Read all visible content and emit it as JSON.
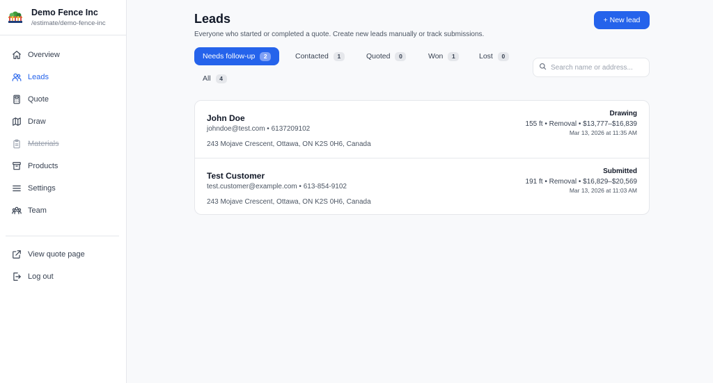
{
  "brand": {
    "name": "Demo Fence Inc",
    "path": "/estimate/demo-fence-inc",
    "logo_icon": "fence-logo-icon"
  },
  "sidebar": {
    "items": [
      {
        "label": "Overview",
        "icon": "home-icon"
      },
      {
        "label": "Leads",
        "icon": "users-icon",
        "active": true
      },
      {
        "label": "Quote",
        "icon": "calculator-icon"
      },
      {
        "label": "Draw",
        "icon": "map-icon"
      },
      {
        "label": "Materials",
        "icon": "clipboard-icon",
        "strikethrough": true
      },
      {
        "label": "Products",
        "icon": "archive-icon"
      },
      {
        "label": "Settings",
        "icon": "menu-icon"
      },
      {
        "label": "Team",
        "icon": "team-icon"
      }
    ],
    "footer": [
      {
        "label": "View quote page",
        "icon": "external-link-icon"
      },
      {
        "label": "Log out",
        "icon": "logout-icon"
      }
    ]
  },
  "page": {
    "title": "Leads",
    "subtitle": "Everyone who started or completed a quote. Create new leads manually or track submissions.",
    "new_lead_label": "+ New lead"
  },
  "tabs": [
    {
      "label": "Needs follow-up",
      "count": "2",
      "active": true
    },
    {
      "label": "Contacted",
      "count": "1"
    },
    {
      "label": "Quoted",
      "count": "0"
    },
    {
      "label": "Won",
      "count": "1"
    },
    {
      "label": "Lost",
      "count": "0"
    },
    {
      "label": "All",
      "count": "4"
    }
  ],
  "search": {
    "placeholder": "Search name or address...",
    "value": ""
  },
  "leads": [
    {
      "name": "John Doe",
      "contact": "johndoe@test.com • 6137209102",
      "address": "243 Mojave Crescent, Ottawa, ON K2S 0H6, Canada",
      "status": "Drawing",
      "detail": "155 ft • Removal • $13,777–$16,839",
      "date": "Mar 13, 2026 at 11:35 AM"
    },
    {
      "name": "Test Customer",
      "contact": "test.customer@example.com • 613-854-9102",
      "address": "243 Mojave Crescent, Ottawa, ON K2S 0H6, Canada",
      "status": "Submitted",
      "detail": "191 ft • Removal • $16,829–$20,569",
      "date": "Mar 13, 2026 at 11:03 AM"
    }
  ],
  "colors": {
    "accent": "#2563eb",
    "border": "#e5e7eb",
    "background": "#f8f9fb"
  }
}
